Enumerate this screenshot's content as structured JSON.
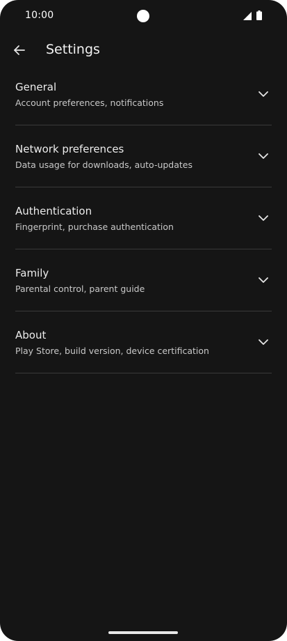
{
  "status_bar": {
    "time": "10:00",
    "icons": [
      "camera-cutout",
      "signal-icon",
      "battery-icon"
    ]
  },
  "app_bar": {
    "back_icon": "arrow-back-icon",
    "title": "Settings"
  },
  "settings": {
    "items": [
      {
        "title": "General",
        "subtitle": "Account preferences, notifications"
      },
      {
        "title": "Network preferences",
        "subtitle": "Data usage for downloads, auto-updates"
      },
      {
        "title": "Authentication",
        "subtitle": "Fingerprint, purchase authentication"
      },
      {
        "title": "Family",
        "subtitle": "Parental control, parent guide"
      },
      {
        "title": "About",
        "subtitle": "Play Store, build version, device certification"
      }
    ],
    "expand_icon": "chevron-down-icon"
  },
  "colors": {
    "background": "#151515",
    "text_primary": "#ececec",
    "text_secondary": "#c9c9c9",
    "divider": "#3a3a3a"
  }
}
